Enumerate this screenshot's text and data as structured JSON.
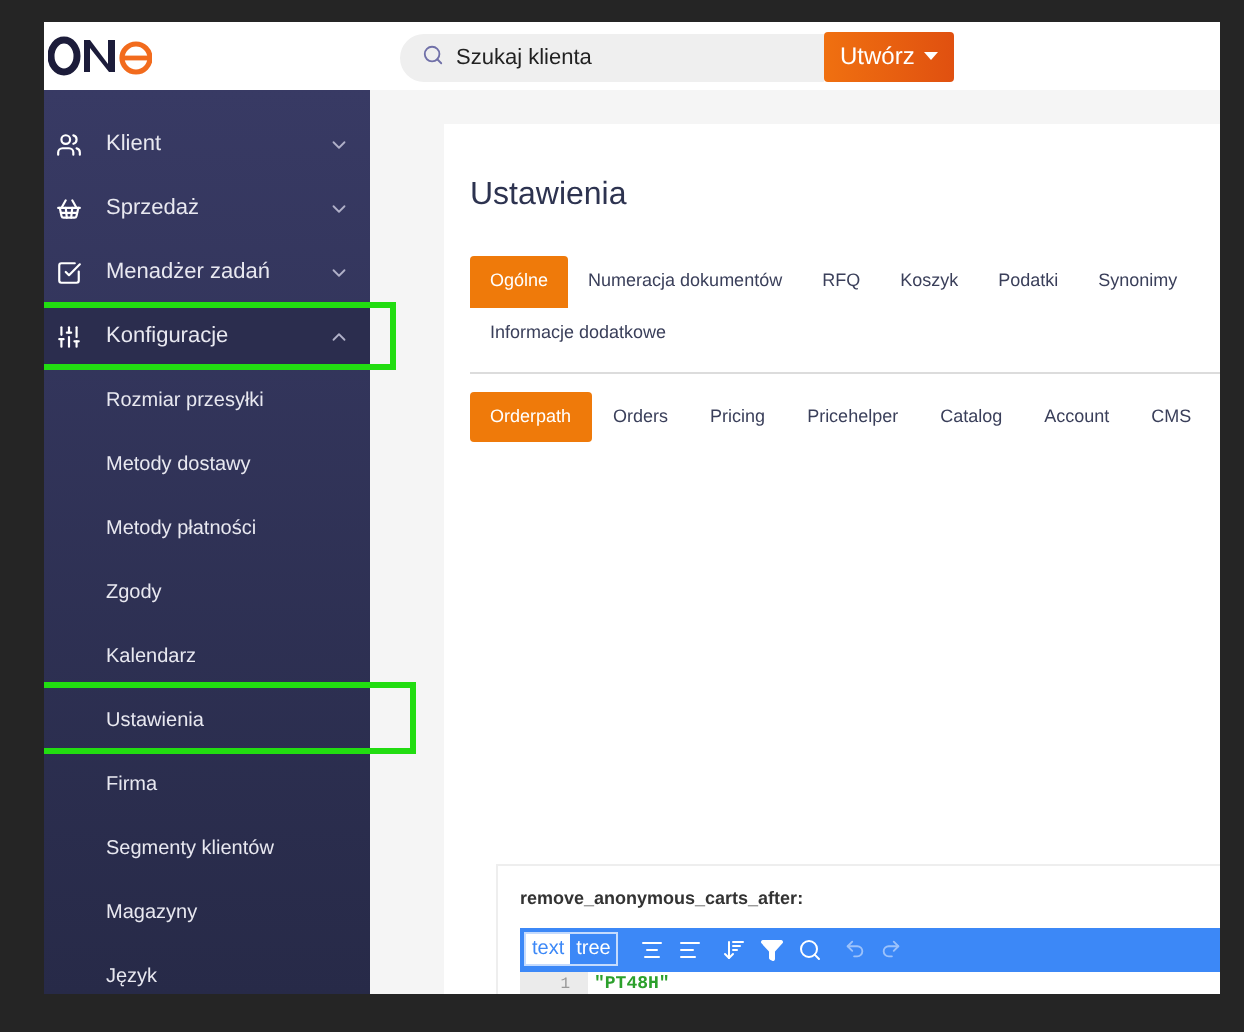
{
  "header": {
    "search": {
      "placeholder": "Szukaj klienta"
    },
    "create_button": "Utwórz"
  },
  "sidebar": {
    "items": [
      {
        "label": "Klient",
        "expanded": false,
        "highlighted": false
      },
      {
        "label": "Sprzedaż",
        "expanded": false,
        "highlighted": false
      },
      {
        "label": "Menadżer zadań",
        "expanded": false,
        "highlighted": false
      },
      {
        "label": "Konfiguracje",
        "expanded": true,
        "highlighted": true,
        "children": [
          {
            "label": "Rozmiar przesyłki",
            "highlighted": false
          },
          {
            "label": "Metody dostawy",
            "highlighted": false
          },
          {
            "label": "Metody płatności",
            "highlighted": false
          },
          {
            "label": "Zgody",
            "highlighted": false
          },
          {
            "label": "Kalendarz",
            "highlighted": false
          },
          {
            "label": "Ustawienia",
            "highlighted": true
          },
          {
            "label": "Firma",
            "highlighted": false
          },
          {
            "label": "Segmenty klientów",
            "highlighted": false
          },
          {
            "label": "Magazyny",
            "highlighted": false
          },
          {
            "label": "Język",
            "highlighted": false
          }
        ]
      }
    ]
  },
  "page": {
    "title": "Ustawienia",
    "tabs": [
      {
        "label": "Ogólne",
        "selected": true
      },
      {
        "label": "Numeracja dokumentów",
        "selected": false
      },
      {
        "label": "RFQ",
        "selected": false
      },
      {
        "label": "Koszyk",
        "selected": false
      },
      {
        "label": "Podatki",
        "selected": false
      },
      {
        "label": "Synonimy",
        "selected": false
      },
      {
        "label": "Informacje dodatkowe",
        "selected": false
      }
    ],
    "subtabs": [
      {
        "label": "Orderpath",
        "selected": true
      },
      {
        "label": "Orders",
        "selected": false
      },
      {
        "label": "Pricing",
        "selected": false
      },
      {
        "label": "Pricehelper",
        "selected": false
      },
      {
        "label": "Catalog",
        "selected": false
      },
      {
        "label": "Account",
        "selected": false
      },
      {
        "label": "CMS",
        "selected": false
      }
    ],
    "editor": {
      "label": "remove_anonymous_carts_after:",
      "modes": [
        {
          "label": "text",
          "selected": true
        },
        {
          "label": "tree",
          "selected": false
        }
      ],
      "lines": [
        {
          "number": "1",
          "code": "\"PT48H\""
        }
      ]
    }
  }
}
